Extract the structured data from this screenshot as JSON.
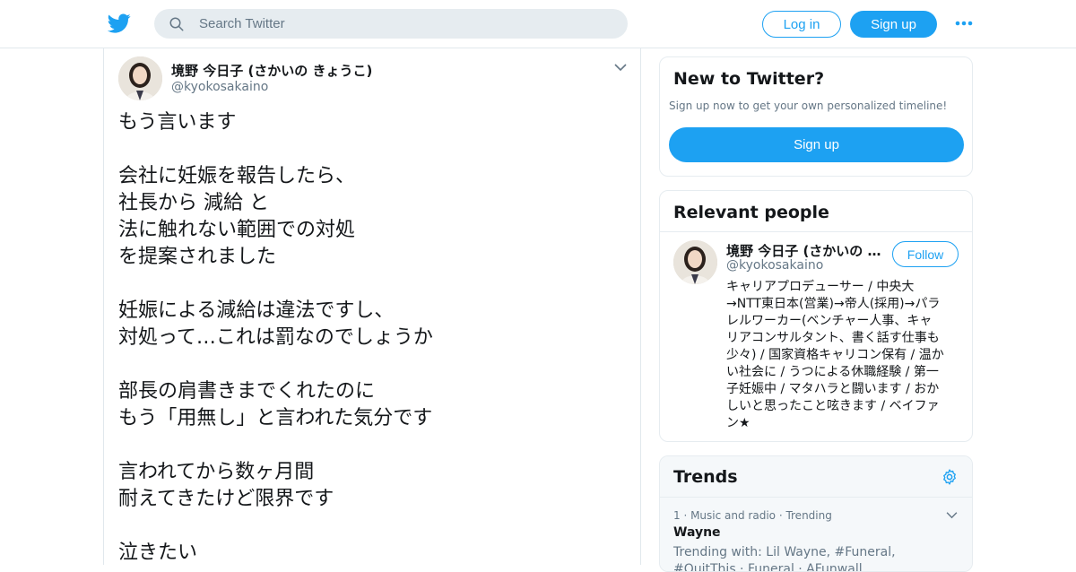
{
  "header": {
    "logo_icon": "twitter-bird-icon",
    "search_placeholder": "Search Twitter",
    "login_label": "Log in",
    "signup_label": "Sign up",
    "more_icon": "more-dots-icon",
    "brand_color": "#1da1f2"
  },
  "tweet": {
    "author_name": "境野 今日子 (さかいの きょうこ)",
    "author_handle": "@kyokosakaino",
    "lines": [
      "もう言います",
      "",
      "会社に妊娠を報告したら、",
      "社長から 減給 と",
      "法に触れない範囲での対処",
      "を提案されました",
      "",
      "妊娠による減給は違法ですし、",
      "対処って…これは罰なのでしょうか",
      "",
      "部長の肩書きまでくれたのに",
      "もう「用無し」と言われた気分です",
      "",
      "言われてから数ヶ月間",
      "耐えてきたけど限界です",
      "",
      "泣きたい"
    ]
  },
  "new_to_twitter": {
    "title": "New to Twitter?",
    "subtitle": "Sign up now to get your own personalized timeline!",
    "button_label": "Sign up"
  },
  "relevant_people": {
    "title": "Relevant people",
    "name": "境野 今日子 (さかいの …",
    "handle": "@kyokosakaino",
    "follow_label": "Follow",
    "bio_lines": [
      "キャリアプロデューサー / 中央大",
      "→NTT東日本(営業)→帝人(採用)→パラ",
      "レルワーカー(ベンチャー人事、キャ",
      "リアコンサルタント、書く話す仕事も",
      "少々) / 国家資格キャリコン保有 / 温か",
      "い社会に / うつによる休職経験 / 第一",
      "子妊娠中 / マタハラと闘います / おか",
      "しいと思ったこと呟きます / ベイファ",
      "ン★"
    ]
  },
  "trends": {
    "title": "Trends",
    "items": [
      {
        "meta": "1 · Music and radio · Trending",
        "name": "Wayne",
        "trending_with": "Trending with: Lil Wayne, #Funeral,",
        "trending_with_2": "#QuitThis · Funeral · AFunwall"
      }
    ]
  }
}
